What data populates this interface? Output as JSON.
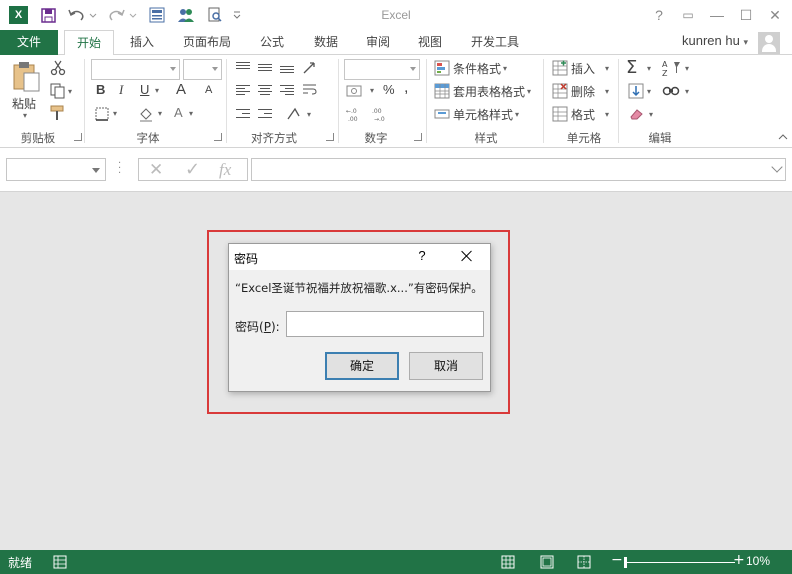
{
  "app": {
    "title": "Excel",
    "logo_letter": "X",
    "window_buttons": [
      "?",
      "▭",
      "—",
      "☐",
      "✕"
    ]
  },
  "tabs": {
    "file": "文件",
    "items": [
      "开始",
      "插入",
      "页面布局",
      "公式",
      "数据",
      "审阅",
      "视图",
      "开发工具"
    ],
    "active": "开始",
    "user": "kunren hu"
  },
  "ribbon": {
    "clipboard": {
      "label": "剪贴板",
      "paste": "粘贴"
    },
    "font": {
      "label": "字体",
      "bold": "B",
      "italic": "I",
      "underline": "U",
      "grow": "A",
      "shrink": "A"
    },
    "alignment": {
      "label": "对齐方式"
    },
    "number": {
      "label": "数字",
      "percent": "%",
      "comma": ","
    },
    "styles": {
      "label": "样式",
      "conditional_format": "条件格式",
      "format_as_table": "套用表格格式",
      "cell_styles": "单元格样式"
    },
    "cells": {
      "label": "单元格",
      "insert": "插入",
      "delete": "删除",
      "format": "格式"
    },
    "editing": {
      "label": "编辑"
    }
  },
  "formula_bar": {
    "cancel": "✕",
    "enter": "✓",
    "fx": "fx"
  },
  "dialog": {
    "title": "密码",
    "help": "?",
    "message": "“Excel圣诞节祝福并放祝福歌.x...”有密码保护。",
    "field_label_prefix": "密码(",
    "field_label_key": "P",
    "field_label_suffix": "):",
    "password_value": "",
    "ok": "确定",
    "cancel": "取消"
  },
  "status": {
    "ready": "就绪",
    "zoom": "10%"
  },
  "colors": {
    "excel_green": "#217346",
    "highlight_red": "#d93a3a"
  }
}
